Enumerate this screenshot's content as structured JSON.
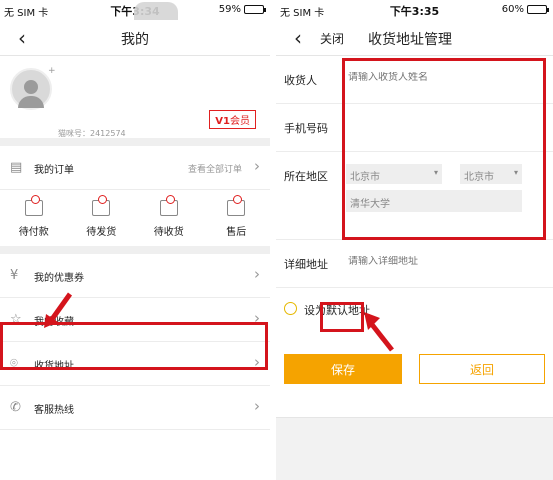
{
  "left": {
    "status": {
      "carrier": "无 SIM 卡 ",
      "time": "下午3:34",
      "battery": "59%",
      "battery_level": 0.59
    },
    "nav": {
      "title": "我的"
    },
    "profile": {
      "user_id": "猫咪号：2412574",
      "vip_badge": "会员",
      "vip_prefix": "V1"
    },
    "orders_row": {
      "label": "我的订单",
      "view_all": "查看全部订单"
    },
    "order_statuses": [
      {
        "label": "待付款",
        "icon": "wallet-icon"
      },
      {
        "label": "待发货",
        "icon": "box-icon"
      },
      {
        "label": "待收货",
        "icon": "truck-icon"
      },
      {
        "label": "售后",
        "icon": "refund-icon"
      }
    ],
    "menu": [
      {
        "label": "我的优惠券",
        "icon": "coupon-icon"
      },
      {
        "label": "我的收藏",
        "icon": "star-icon"
      },
      {
        "label": "收货地址",
        "icon": "location-icon"
      },
      {
        "label": "客服热线",
        "icon": "phone-icon"
      }
    ]
  },
  "right": {
    "status": {
      "carrier": "无 SIM 卡 ",
      "time": "下午3:35",
      "battery": "60%",
      "battery_level": 0.6
    },
    "nav": {
      "close": "关闭",
      "title": "收货地址管理"
    },
    "form": {
      "name_label": "收货人",
      "name_placeholder": "请输入收货人姓名",
      "phone_label": "手机号码",
      "region_label": "所在地区",
      "province": "北京市",
      "city": "北京市",
      "district": "清华大学",
      "address_label": "详细地址",
      "address_placeholder": "请输入详细地址"
    },
    "default_label": "设为默认地址",
    "save_label": "保存",
    "return_label": "返回"
  },
  "colors": {
    "accent": "#f5a300",
    "highlight": "#d4141c"
  }
}
